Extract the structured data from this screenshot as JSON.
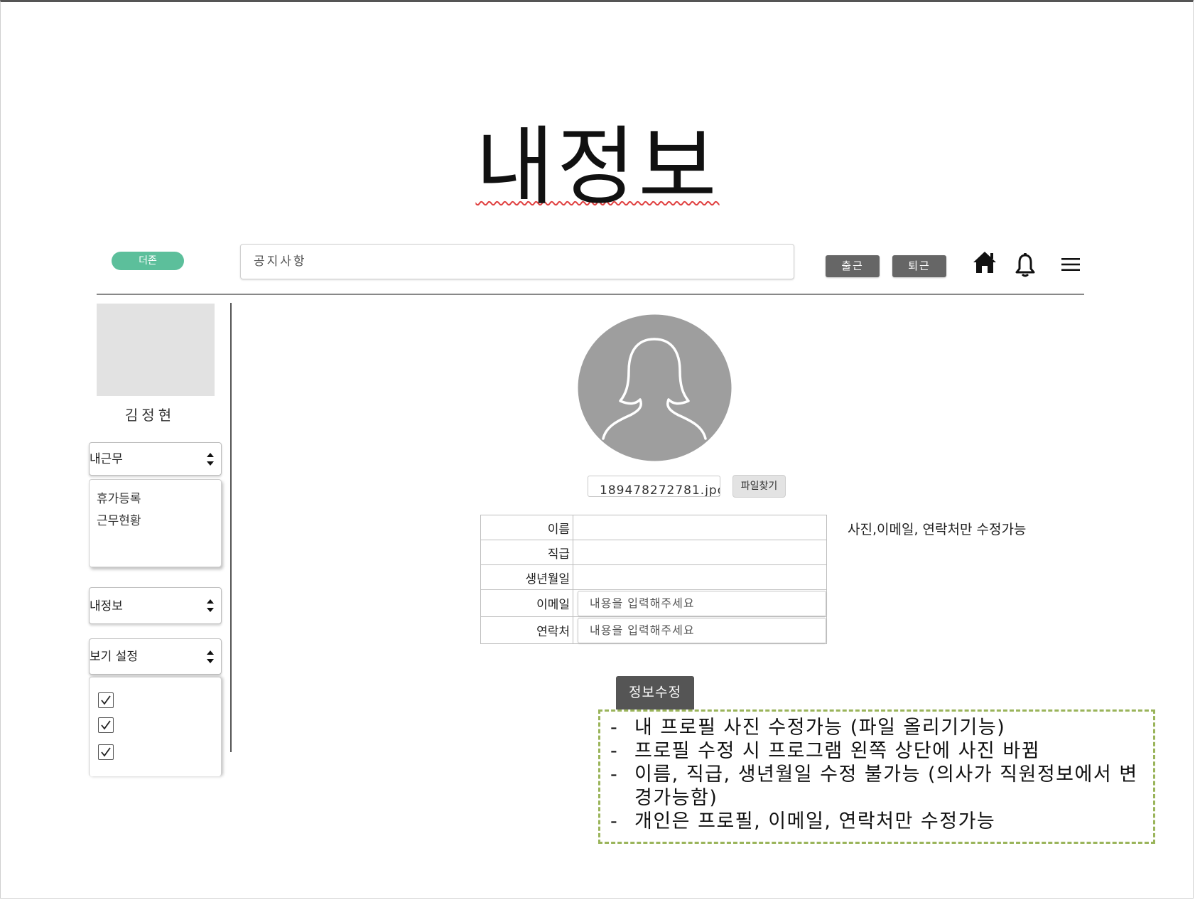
{
  "page": {
    "title": "내정보"
  },
  "header": {
    "brand": "더존",
    "notice_placeholder": "공지사항",
    "clock_in_label": "출근",
    "clock_out_label": "퇴근",
    "icons": [
      "home-icon",
      "bell-icon",
      "menu-icon"
    ]
  },
  "sidebar": {
    "user_name": "김정현",
    "work_select": {
      "selected": "내근무",
      "items": [
        "휴가등록",
        "근무현황"
      ]
    },
    "info_select": {
      "selected": "내정보"
    },
    "view_select": {
      "selected": "보기 설정",
      "checkboxes": [
        true,
        true,
        true
      ]
    }
  },
  "profile": {
    "avatar_icon": "person-silhouette-icon",
    "file_name": "189478272781.jpg",
    "file_button_label": "파일찾기",
    "fields": [
      {
        "label": "이름",
        "editable": false
      },
      {
        "label": "직급",
        "editable": false
      },
      {
        "label": "생년월일",
        "editable": false
      },
      {
        "label": "이메일",
        "editable": true,
        "placeholder": "내용을 입력해주세요"
      },
      {
        "label": "연락처",
        "editable": true,
        "placeholder": "내용을 입력해주세요"
      }
    ],
    "side_note": "사진,이메일, 연락처만 수정가능",
    "edit_button_label": "정보수정"
  },
  "memo": {
    "lines": [
      "내 프로필 사진 수정가능 (파일 올리기기능)",
      "프로필 수정 시 프로그램 왼쪽 상단에 사진 바뀜",
      "이름, 직급, 생년월일 수정 불가능 (의사가 직원정보에서 변경가능함)",
      "개인은 프로필, 이메일, 연락처만 수정가능"
    ]
  },
  "colors": {
    "brand_green": "#5cbf9b",
    "dark_button": "#666666",
    "memo_border": "#9ab45a",
    "avatar_fill": "#9e9e9e"
  }
}
